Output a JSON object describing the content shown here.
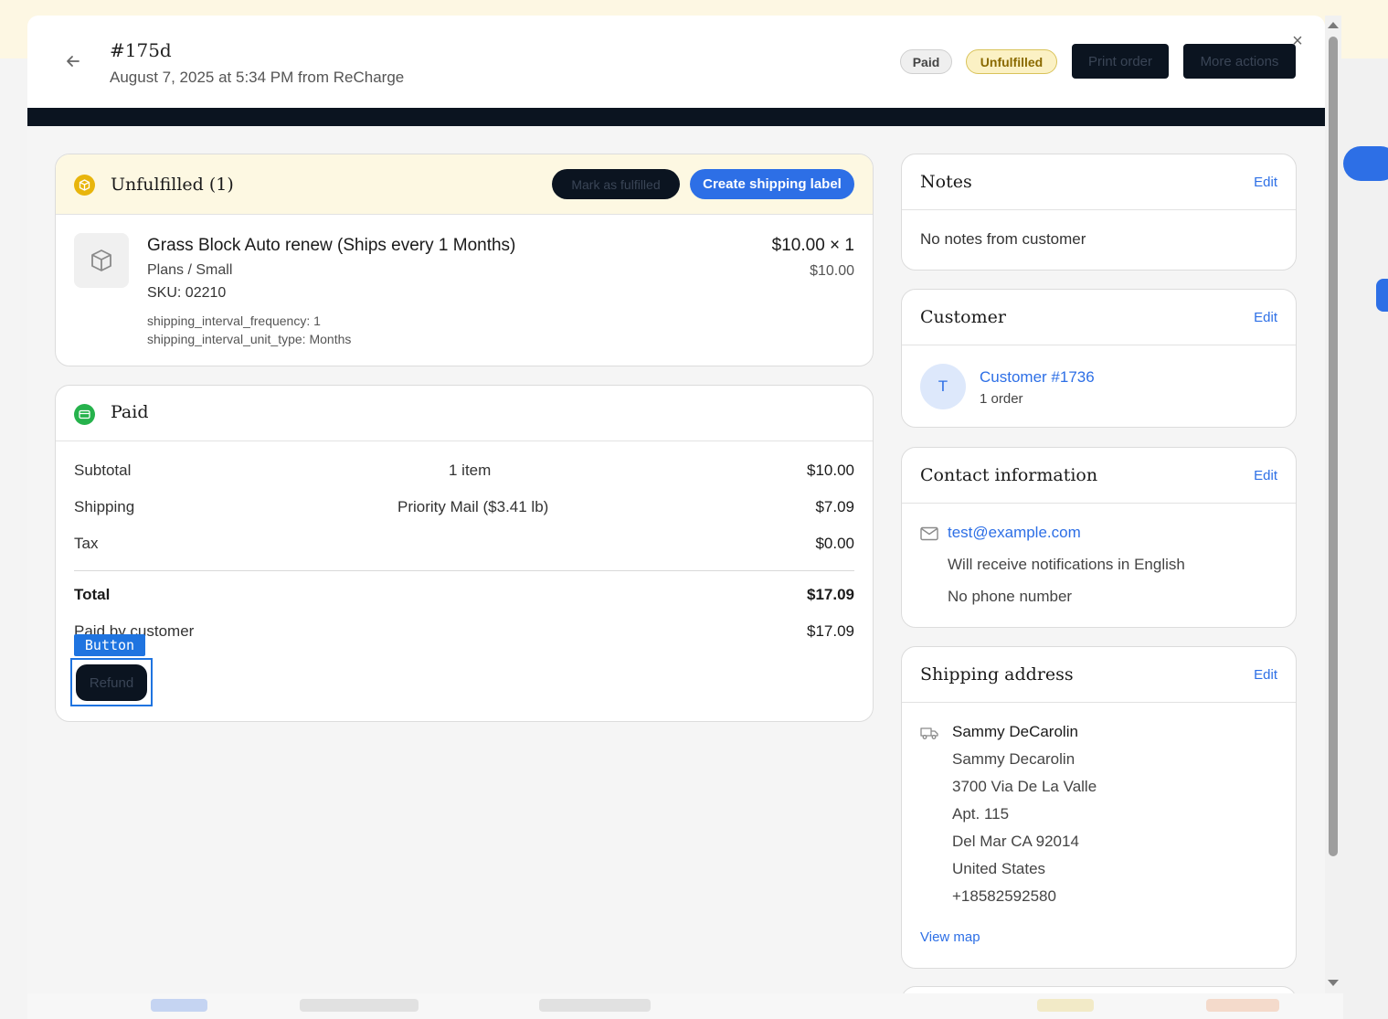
{
  "header": {
    "order_number": "#175d",
    "subtitle": "August 7, 2025 at 5:34 PM from ReCharge",
    "badges": {
      "paid": "Paid",
      "unfulfilled": "Unfulfilled"
    },
    "print_order": "Print order",
    "more_actions": "More actions"
  },
  "unfulfilled": {
    "title": "Unfulfilled (1)",
    "mark_fulfilled": "Mark as fulfilled",
    "create_label": "Create shipping label",
    "item": {
      "name": "Grass Block Auto renew (Ships every 1 Months)",
      "variant": "Plans / Small",
      "sku": "SKU: 02210",
      "prop1": "shipping_interval_frequency: 1",
      "prop2": "shipping_interval_unit_type: Months",
      "price_qty": "$10.00 × 1",
      "line_total": "$10.00"
    }
  },
  "paid": {
    "title": "Paid",
    "rows": {
      "subtotal": {
        "label": "Subtotal",
        "mid": "1 item",
        "amount": "$10.00"
      },
      "shipping": {
        "label": "Shipping",
        "mid": "Priority Mail ($3.41 lb)",
        "amount": "$7.09"
      },
      "tax": {
        "label": "Tax",
        "amount": "$0.00"
      },
      "total": {
        "label": "Total",
        "amount": "$17.09"
      },
      "paid_by": {
        "label": "Paid by customer",
        "amount": "$17.09"
      }
    },
    "refund": "Refund",
    "highlight_tag": "Button"
  },
  "notes": {
    "title": "Notes",
    "edit": "Edit",
    "body": "No notes from customer"
  },
  "customer": {
    "title": "Customer",
    "edit": "Edit",
    "avatar": "T",
    "name": "Customer #1736",
    "orders": "1 order"
  },
  "contact": {
    "title": "Contact information",
    "edit": "Edit",
    "email": "test@example.com",
    "language": "Will receive notifications in English",
    "phone": "No phone number"
  },
  "shipping_address": {
    "title": "Shipping address",
    "edit": "Edit",
    "name": "Sammy DeCarolin",
    "lines": [
      "Sammy Decarolin",
      "3700 Via De La Valle",
      "Apt. 115",
      "Del Mar CA 92014",
      "United States",
      "+18582592580"
    ],
    "view_map": "View map"
  },
  "colors": {
    "accent": "#2d6fe6",
    "dark": "#0b1420",
    "warning_bg": "#fdf8e2",
    "success": "#26b24c"
  },
  "icons": [
    "back-arrow-icon",
    "close-icon",
    "package-icon",
    "credit-card-icon",
    "mail-icon",
    "truck-icon",
    "box-icon"
  ]
}
